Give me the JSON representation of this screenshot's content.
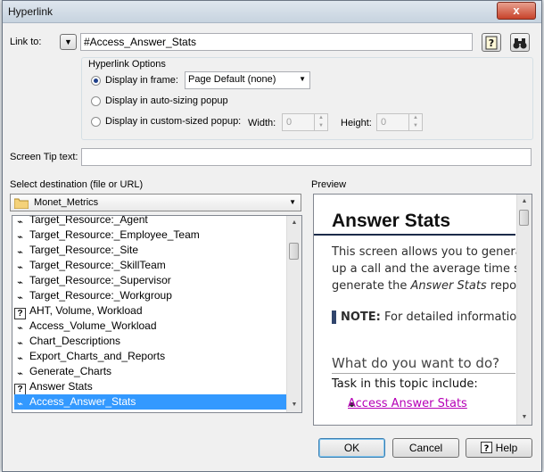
{
  "dialog": {
    "title": "Hyperlink",
    "close_glyph": "x"
  },
  "link_to": {
    "label": "Link to:",
    "value": "#Access_Answer_Stats"
  },
  "hyperlink_options": {
    "legend": "Hyperlink Options",
    "display_in_frame": "Display in frame:",
    "frame_value": "Page Default (none)",
    "auto_sizing": "Display in auto-sizing popup",
    "custom_sized": "Display in custom-sized popup:",
    "width_label": "Width:",
    "width_value": "0",
    "height_label": "Height:",
    "height_value": "0"
  },
  "screen_tip": {
    "label": "Screen Tip text:",
    "value": ""
  },
  "destination": {
    "label": "Select destination (file or URL)",
    "folder": "Monet_Metrics",
    "items": [
      {
        "label": "Target_Resource:_Agent",
        "icon": "link-icon"
      },
      {
        "label": "Target_Resource:_Employee_Team",
        "icon": "link-icon"
      },
      {
        "label": "Target_Resource:_Site",
        "icon": "link-icon"
      },
      {
        "label": "Target_Resource:_SkillTeam",
        "icon": "link-icon"
      },
      {
        "label": "Target_Resource:_Supervisor",
        "icon": "link-icon"
      },
      {
        "label": "Target_Resource:_Workgroup",
        "icon": "link-icon"
      },
      {
        "label": "AHT, Volume, Workload",
        "icon": "help-topic-icon"
      },
      {
        "label": "Access_Volume_Workload",
        "icon": "link-icon"
      },
      {
        "label": "Chart_Descriptions",
        "icon": "link-icon"
      },
      {
        "label": "Export_Charts_and_Reports",
        "icon": "link-icon"
      },
      {
        "label": "Generate_Charts",
        "icon": "link-icon"
      },
      {
        "label": "Answer Stats",
        "icon": "help-topic-icon"
      },
      {
        "label": "Access_Answer_Stats",
        "icon": "link-icon",
        "selected": true
      }
    ]
  },
  "preview": {
    "label": "Preview",
    "heading": "Answer Stats",
    "body_line1": "This screen allows you to genera",
    "body_line2": "up a call and the average time s",
    "body_line3_pre": "generate the ",
    "body_line3_em": "Answer Stats",
    "body_line3_post": " repor",
    "note_label": "NOTE:",
    "note_text": " For detailed informatio",
    "subheading": "What do you want to do?",
    "task_intro": "Task in this topic include:",
    "task_link": "Access Answer Stats"
  },
  "buttons": {
    "ok": "OK",
    "cancel": "Cancel",
    "help": "Help"
  },
  "colors": {
    "selection": "#3399ff",
    "link": "#b600b6",
    "accent": "#1f3f8a"
  }
}
